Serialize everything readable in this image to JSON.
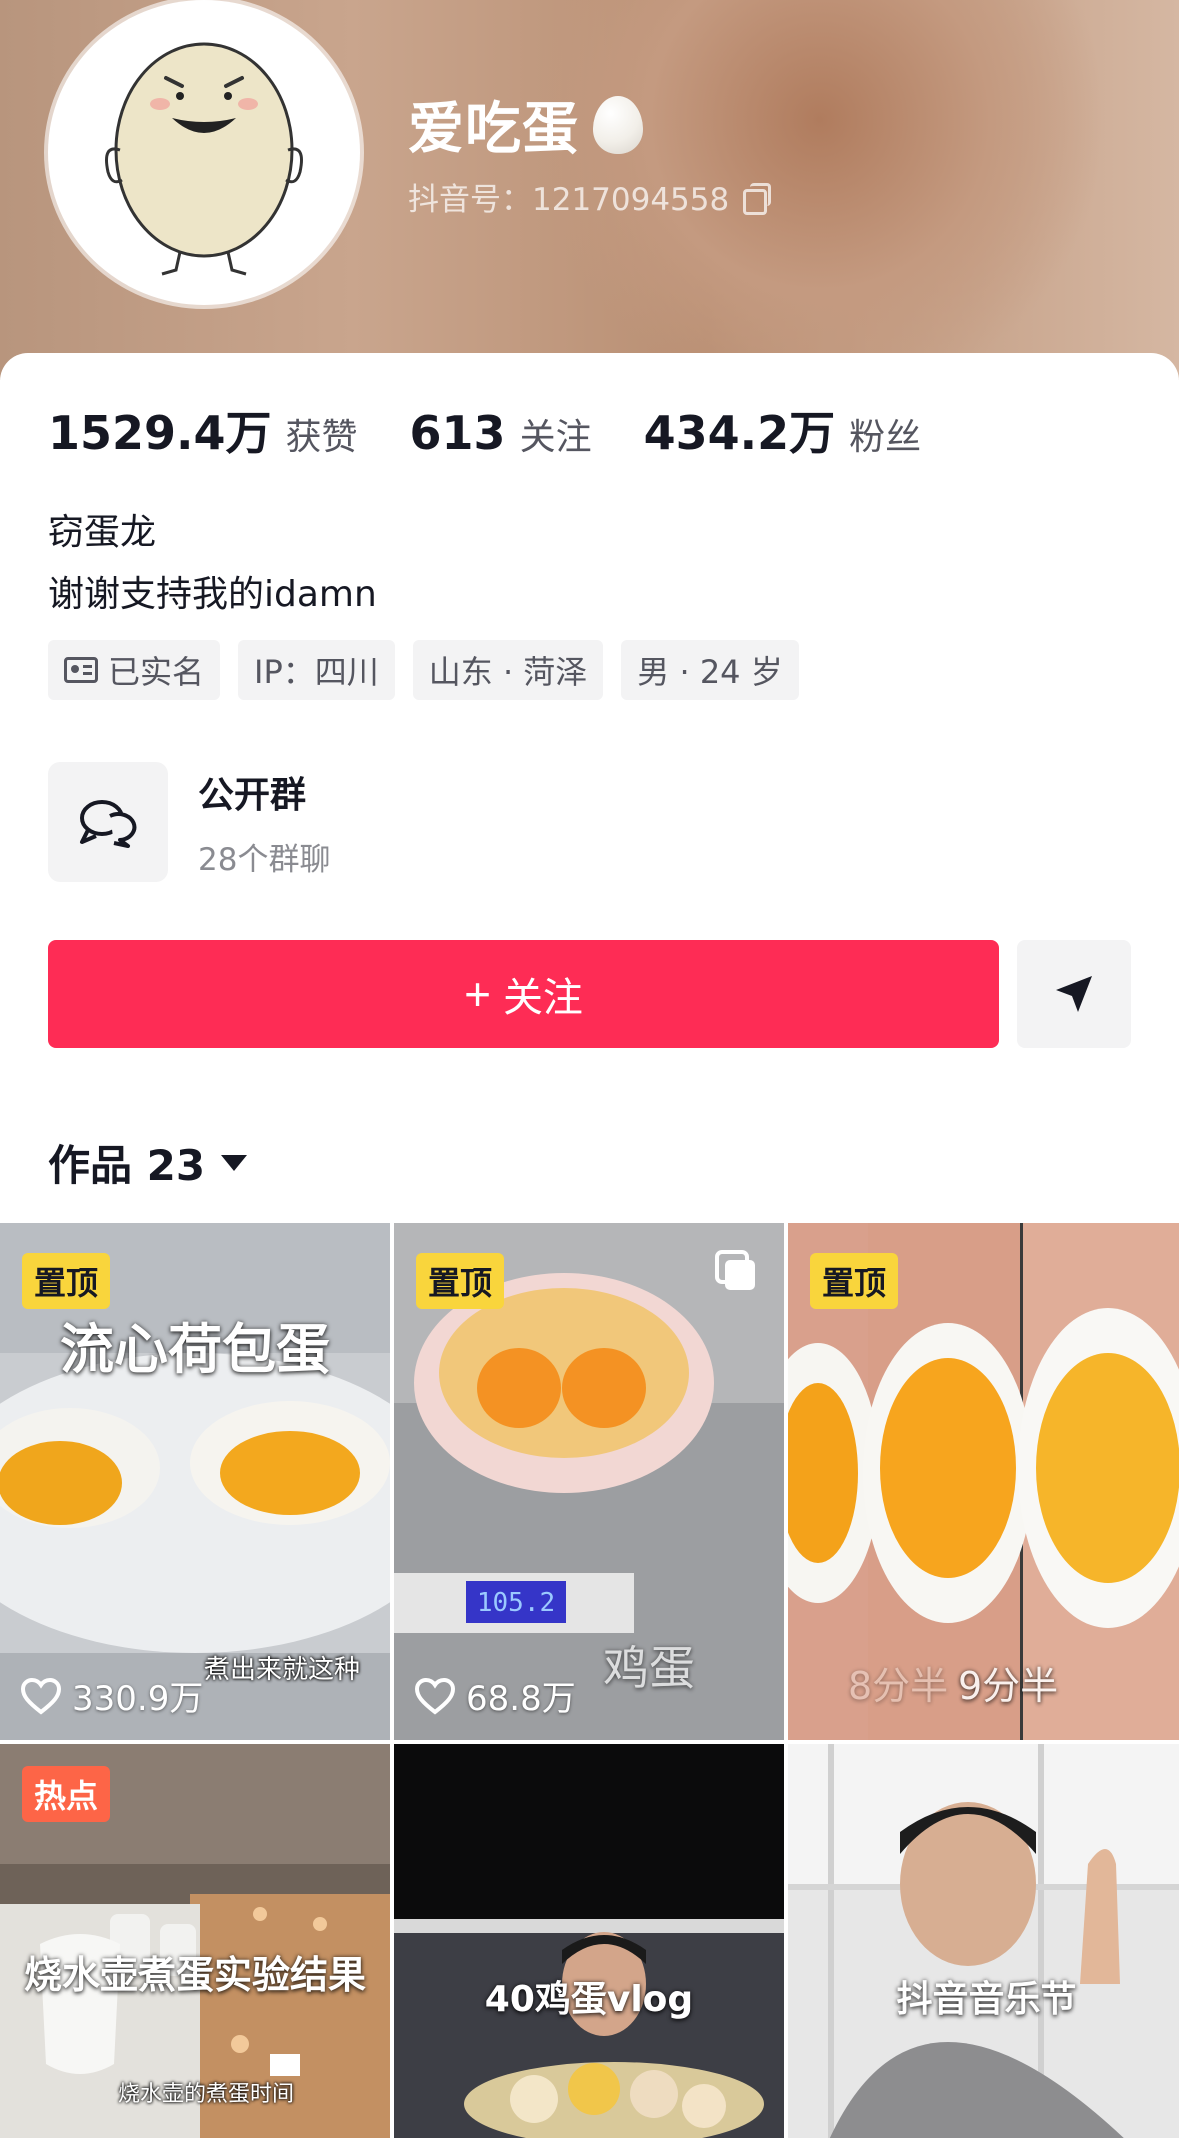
{
  "profile": {
    "nickname": "爱吃蛋",
    "douyin_id": "抖音号：1217094558"
  },
  "stats": [
    {
      "value": "1529.4万",
      "label": "获赞"
    },
    {
      "value": "613",
      "label": "关注"
    },
    {
      "value": "434.2万",
      "label": "粉丝"
    }
  ],
  "bio": {
    "line1": "窃蛋龙",
    "line2": "谢谢支持我的idamn"
  },
  "tags": {
    "verified": "已实名",
    "ip": "IP：四川",
    "location": "山东 · 菏泽",
    "gender_age": "男 · 24 岁"
  },
  "group": {
    "title": "公开群",
    "subtitle": "28个群聊"
  },
  "actions": {
    "follow_plus": "+",
    "follow_label": "关注"
  },
  "works_tab": {
    "label": "作品 23"
  },
  "videos": [
    {
      "badge": "置顶",
      "caption": "流心荷包蛋",
      "subtitle": "煮出来就这种",
      "likes": "330.9万"
    },
    {
      "badge": "置顶",
      "caption": "鸡蛋",
      "scale": "105.2",
      "likes": "68.8万"
    },
    {
      "badge": "置顶",
      "caption": "9分半",
      "caption2": "8分半"
    },
    {
      "badge": "热点",
      "caption": "烧水壶煮蛋实验结果",
      "subtitle": "烧水壶的煮蛋时间"
    },
    {
      "caption": "40鸡蛋vlog"
    },
    {
      "caption": "抖音音乐节"
    }
  ],
  "colors": {
    "accent": "#fe2c55",
    "pin_badge": "#f9d53c",
    "hot_badge": "#fd6547"
  }
}
